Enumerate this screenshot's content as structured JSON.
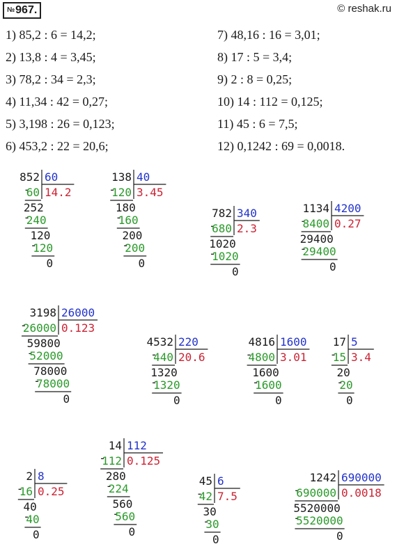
{
  "problem_number_prefix": "№",
  "problem_number": "967.",
  "watermark": "© reshak.ru",
  "equations_left": [
    "1) 85,2 : 6 = 14,2;",
    "2) 13,8 : 4 = 3,45;",
    "3) 78,2 : 34 = 2,3;",
    "4) 11,34 : 42 = 0,27;",
    "5) 3,198 : 26 = 0,123;",
    "6) 453,2 : 22 = 20,6;"
  ],
  "equations_right": [
    "7) 48,16 : 16 = 3,01;",
    "8) 17 : 5 = 3,4;",
    "9) 2 : 8 = 0,25;",
    "10) 14 : 112 = 0,125;",
    "11) 45 : 6 = 7,5;",
    "12) 0,1242 : 69 = 0,0018."
  ],
  "divisions": [
    {
      "id": "d1",
      "dividend": "852",
      "divisor": "60",
      "quotient": "14.2",
      "steps": [
        [
          "60",
          "252"
        ],
        [
          "240",
          "120"
        ],
        [
          "120",
          "0"
        ]
      ]
    },
    {
      "id": "d2",
      "dividend": "138",
      "divisor": "40",
      "quotient": "3.45",
      "steps": [
        [
          "120",
          "180"
        ],
        [
          "160",
          "200"
        ],
        [
          "200",
          "0"
        ]
      ]
    },
    {
      "id": "d3",
      "dividend": "782",
      "divisor": "340",
      "quotient": "2.3",
      "steps": [
        [
          "680",
          "1020"
        ],
        [
          "1020",
          "0"
        ]
      ]
    },
    {
      "id": "d4",
      "dividend": "1134",
      "divisor": "4200",
      "quotient": "0.27",
      "steps": [
        [
          "8400",
          "29400"
        ],
        [
          "29400",
          "0"
        ]
      ]
    },
    {
      "id": "d5",
      "dividend": "3198",
      "divisor": "26000",
      "quotient": "0.123",
      "steps": [
        [
          "26000",
          "59800"
        ],
        [
          "52000",
          "78000"
        ],
        [
          "78000",
          "0"
        ]
      ]
    },
    {
      "id": "d6",
      "dividend": "4532",
      "divisor": "220",
      "quotient": "20.6",
      "steps": [
        [
          "440",
          "1320"
        ],
        [
          "1320",
          "0"
        ]
      ]
    },
    {
      "id": "d7",
      "dividend": "4816",
      "divisor": "1600",
      "quotient": "3.01",
      "steps": [
        [
          "4800",
          "1600"
        ],
        [
          "1600",
          "0"
        ]
      ]
    },
    {
      "id": "d8",
      "dividend": "17",
      "divisor": "5",
      "quotient": "3.4",
      "steps": [
        [
          "15",
          "20"
        ],
        [
          "20",
          "0"
        ]
      ]
    },
    {
      "id": "d9",
      "dividend": "2",
      "divisor": "8",
      "quotient": "0.25",
      "steps": [
        [
          "16",
          "40"
        ],
        [
          "40",
          "0"
        ]
      ]
    },
    {
      "id": "d10",
      "dividend": "14",
      "divisor": "112",
      "quotient": "0.125",
      "steps": [
        [
          "112",
          "280"
        ],
        [
          "224",
          "560"
        ],
        [
          "560",
          "0"
        ]
      ]
    },
    {
      "id": "d11",
      "dividend": "45",
      "divisor": "6",
      "quotient": "7.5",
      "steps": [
        [
          "42",
          "30"
        ],
        [
          "30",
          "0"
        ]
      ]
    },
    {
      "id": "d12",
      "dividend": "1242",
      "divisor": "690000",
      "quotient": "0.0018",
      "steps": [
        [
          "690000",
          "5520000"
        ],
        [
          "5520000",
          "0"
        ]
      ]
    }
  ],
  "colors": {
    "subtrahend": "#2a9a2a",
    "divisor": "#2233cc",
    "quotient": "#cc2233",
    "text": "#1a1a1a"
  }
}
